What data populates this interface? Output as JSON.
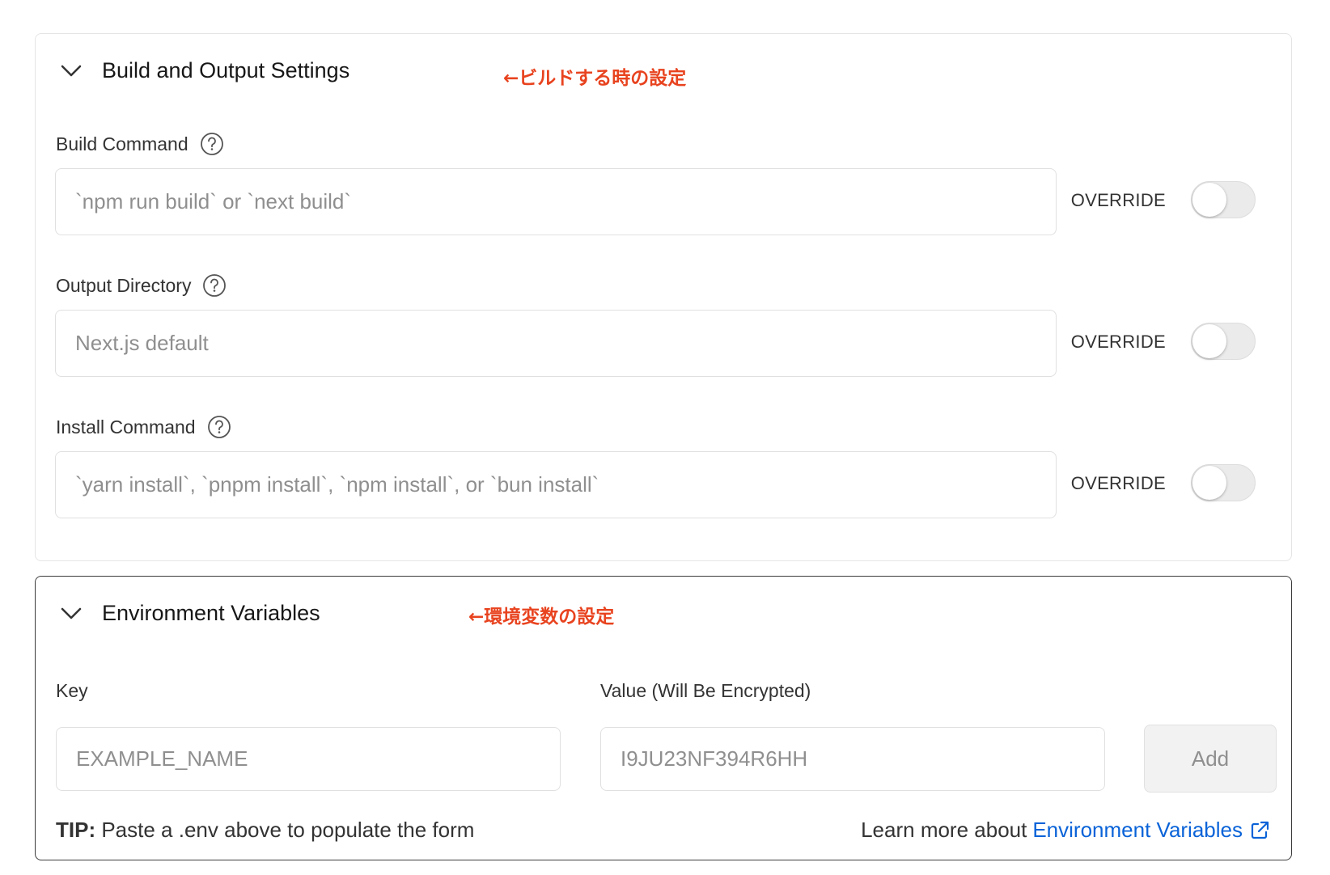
{
  "build_section": {
    "title": "Build and Output Settings",
    "annotation": "←ビルドする時の設定",
    "fields": [
      {
        "label": "Build Command",
        "placeholder": "`npm run build` or `next build`",
        "override_label": "OVERRIDE",
        "override_enabled": false
      },
      {
        "label": "Output Directory",
        "placeholder": "Next.js default",
        "override_label": "OVERRIDE",
        "override_enabled": false
      },
      {
        "label": "Install Command",
        "placeholder": "`yarn install`, `pnpm install`, `npm install`, or `bun install`",
        "override_label": "OVERRIDE",
        "override_enabled": false
      }
    ]
  },
  "env_section": {
    "title": "Environment Variables",
    "annotation": "←環境変数の設定",
    "key_label": "Key",
    "key_placeholder": "EXAMPLE_NAME",
    "value_label": "Value (Will Be Encrypted)",
    "value_placeholder": "I9JU23NF394R6HH",
    "add_label": "Add",
    "tip_prefix": "TIP:",
    "tip_text": "Paste a .env above to populate the form",
    "learn_text": "Learn more about",
    "learn_link": "Environment Variables"
  },
  "icons": {
    "chevron": "chevron-down-icon",
    "help": "help-circle-icon",
    "external": "external-link-icon"
  },
  "colors": {
    "annotation": "#e8431f",
    "link": "#0a63d8",
    "active_border": "#3b3b3b"
  }
}
